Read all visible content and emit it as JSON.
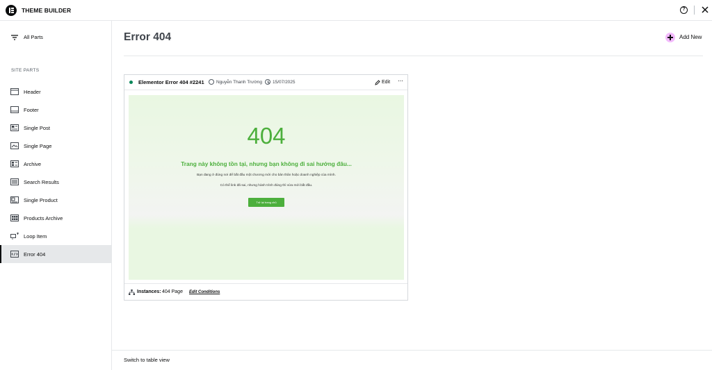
{
  "app": {
    "title": "THEME BUILDER"
  },
  "sidebar": {
    "all_parts_label": "All Parts",
    "section_label": "SITE PARTS",
    "items": [
      {
        "label": "Header",
        "icon": "header-icon"
      },
      {
        "label": "Footer",
        "icon": "footer-icon"
      },
      {
        "label": "Single Post",
        "icon": "single-post-icon"
      },
      {
        "label": "Single Page",
        "icon": "single-page-icon"
      },
      {
        "label": "Archive",
        "icon": "archive-icon"
      },
      {
        "label": "Search Results",
        "icon": "search-results-icon"
      },
      {
        "label": "Single Product",
        "icon": "single-product-icon"
      },
      {
        "label": "Products Archive",
        "icon": "products-archive-icon"
      },
      {
        "label": "Loop Item",
        "icon": "loop-item-icon"
      },
      {
        "label": "Error 404",
        "icon": "error-404-icon",
        "active": true
      }
    ]
  },
  "main": {
    "title": "Error 404",
    "add_new_label": "Add New",
    "switch_view_label": "Switch to table view"
  },
  "card": {
    "status": "published",
    "title": "Elementor Error 404 #2241",
    "author": "Nguyễn Thanh Trường",
    "date": "15/07/2025",
    "edit_label": "Edit",
    "more_label": "···",
    "preview": {
      "code": "404",
      "heading": "Trang này không tồn tại, nhưng bạn không đi sai hướng đâu...",
      "line1": "Bạn đang ở đúng nơi để bắt đầu một chương mới cho bản thân hoặc doanh nghiệp của mình.",
      "line2": "Có thể link đã sai, nhưng hành trình đúng thì vừa mới bắt đầu.",
      "button_label": "Trở lại trang chủ"
    },
    "instances_label": "Instances:",
    "instances_value": "404 Page",
    "edit_conditions_label": "Edit Conditions"
  },
  "colors": {
    "accent_pink": "#f3bafd",
    "status_green": "#0a875a",
    "preview_green": "#4caf3c"
  }
}
